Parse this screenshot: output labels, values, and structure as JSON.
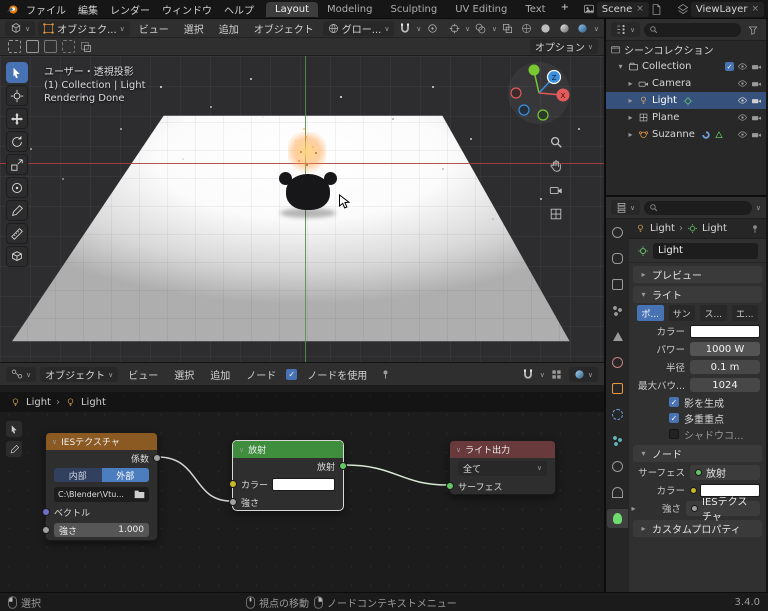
{
  "colors": {
    "accent": "#4772b3",
    "selected_row": "#36527c",
    "ies_header": "#8a5a22",
    "emission_header": "#3e8e3e",
    "output_header": "#693a3c",
    "socket_factor": "#a1a1a1",
    "socket_color": "#c8b728",
    "socket_vector": "#6e6ecb",
    "socket_shader": "#63c763",
    "axis_x": "#e25a5a",
    "axis_y": "#79c831",
    "axis_z": "#3b8edc"
  },
  "topbar": {
    "menus": [
      "ファイル",
      "編集",
      "レンダー",
      "ウィンドウ",
      "ヘルプ"
    ],
    "workspaces": [
      "Layout",
      "Modeling",
      "Sculpting",
      "UV Editing",
      "Text"
    ],
    "scene": "Scene",
    "viewlayer": "ViewLayer"
  },
  "viewport": {
    "header": {
      "mode": "オブジェク...",
      "menus": [
        "ビュー",
        "選択",
        "追加",
        "オブジェクト"
      ],
      "orientation": "グロー...",
      "options": "オプション"
    },
    "overlay": {
      "line1": "ユーザー・透視投影",
      "line2": "(1) Collection | Light",
      "line3": "Rendering Done"
    }
  },
  "outliner": {
    "root": "シーンコレクション",
    "items": [
      {
        "label": "Collection"
      },
      {
        "label": "Camera"
      },
      {
        "label": "Light"
      },
      {
        "label": "Plane"
      },
      {
        "label": "Suzanne"
      }
    ]
  },
  "properties": {
    "breadcrumb": {
      "a": "Light",
      "b": "Light"
    },
    "name": "Light",
    "panels": {
      "preview": "プレビュー",
      "light": "ライト",
      "nodes": "ノード",
      "custom": "カスタムプロパティ"
    },
    "light_types": [
      "ポ...",
      "サン",
      "ス...",
      "エ..."
    ],
    "rows": {
      "color": "カラー",
      "power_label": "パワー",
      "power_value": "1000 W",
      "radius_label": "半径",
      "radius_value": "0.1 m",
      "bounces_label": "最大バウ...",
      "bounces_value": "1024",
      "shadow": "影を生成",
      "mis": "多重重点",
      "caustics": "シャドウコ..."
    },
    "node_rows": {
      "surface_label": "サーフェス",
      "surface_value": "放射",
      "color_label": "カラー",
      "strength_label": "強さ",
      "strength_value": "IESテクスチャ"
    }
  },
  "shader": {
    "header": {
      "mode": "オブジェクト",
      "menus": [
        "ビュー",
        "選択",
        "追加",
        "ノード"
      ],
      "use_nodes": "ノードを使用"
    },
    "breadcrumb": {
      "a": "Light",
      "b": "Light"
    },
    "nodes": {
      "ies": {
        "title": "IESテクスチャ",
        "factor": "係数",
        "internal": "内部",
        "external": "外部",
        "path": "C:\\Blender\\Vtu...",
        "vector": "ベクトル",
        "strength": "強さ",
        "strength_value": "1.000"
      },
      "emission": {
        "title": "放射",
        "out": "放射",
        "color": "カラー",
        "strength": "強さ"
      },
      "output": {
        "title": "ライト出力",
        "target": "全て",
        "surface": "サーフェス"
      }
    }
  },
  "statusbar": {
    "select": "選択",
    "pan": "視点の移動",
    "context": "ノードコンテキストメニュー",
    "version": "3.4.0"
  }
}
